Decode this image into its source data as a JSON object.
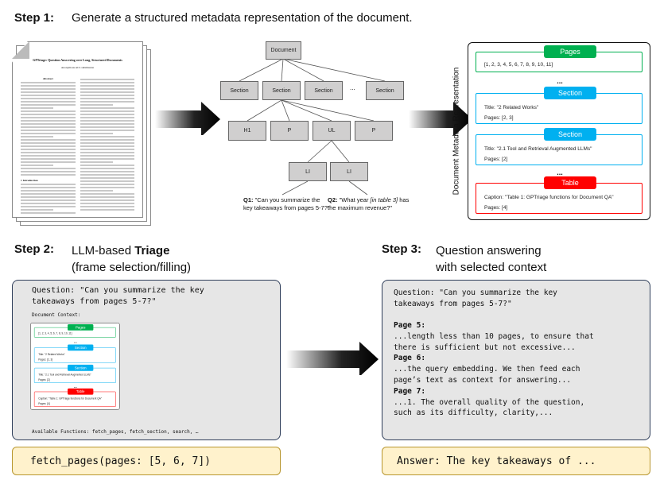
{
  "step1": {
    "label": "Step 1:",
    "text": "Generate a structured metadata representation of the document."
  },
  "step2": {
    "label": "Step 2:",
    "text_prefix": "LLM-based ",
    "text_bold": "Triage",
    "text_line2": "(frame selection/filling)"
  },
  "step3": {
    "label": "Step 3:",
    "text_line1": "Question answering",
    "text_line2": "with selected context"
  },
  "paper": {
    "title": "GPTriage: Question Answering over Long, Structured Documents",
    "author": "Anonymous ACL submission",
    "abstract": "Abstract",
    "intro": "1 Introduction"
  },
  "tree": {
    "root": "Document",
    "sections": [
      "Section",
      "Section",
      "Section",
      "Section"
    ],
    "ellipsis": "...",
    "children": [
      "H1",
      "P",
      "UL",
      "P"
    ],
    "list_items": [
      "LI",
      "LI"
    ],
    "q1_label": "Q1:",
    "q1_text": " \"Can you summarize the key takeaways from pages 5-7?\"",
    "q2_label": "Q2:",
    "q2_pre": " \"What year ",
    "q2_italic": "[in table 3]",
    "q2_post": " has the maximum revenue?\""
  },
  "metadata": {
    "vertical_label": "Document Metadata Representation",
    "pages": {
      "tag": "Pages",
      "value": "[1, 2, 3, 4, 5, 6, 7, 8, 9, 10, 11]"
    },
    "ellipsis": "...",
    "section1": {
      "tag": "Section",
      "title": "Title: \"2 Related Works\"",
      "pages": "Pages: [2, 3]"
    },
    "section2": {
      "tag": "Section",
      "title": "Title: \"2.1 Tool and Retrieval Augmented LLMs\"",
      "pages": "Pages: [2]"
    },
    "table": {
      "tag": "Table",
      "caption": "Caption: \"Table 1: GPTriage functions for Document QA\"",
      "pages": "Pages: [4]"
    },
    "colors": {
      "pages": "#00b050",
      "section": "#00b0f0",
      "table": "#ff0000"
    }
  },
  "triage": {
    "question_line1": "Question: \"Can you summarize the key",
    "question_line2": "takeaways from pages 5-7?\"",
    "context_label": "Document Context:",
    "functions": "Available Functions: fetch_pages, fetch_section, search, …",
    "call": "fetch_pages(pages: [5, 6, 7])"
  },
  "answering": {
    "question_line1": "Question: \"Can you summarize the key",
    "question_line2": "takeaways from pages 5-7?\"",
    "pages": [
      {
        "label": "Page 5:",
        "lines": [
          "...length less than 10 pages, to ensure that",
          "there is sufficient but not excessive..."
        ]
      },
      {
        "label": "Page 6:",
        "lines": [
          "...the query embedding. We then feed each",
          "page’s text as context for answering..."
        ]
      },
      {
        "label": "Page 7:",
        "lines": [
          "...1. The overall quality of the question,",
          "such as its difficulty, clarity,..."
        ]
      }
    ],
    "answer": "Answer: The key takeaways of ..."
  }
}
